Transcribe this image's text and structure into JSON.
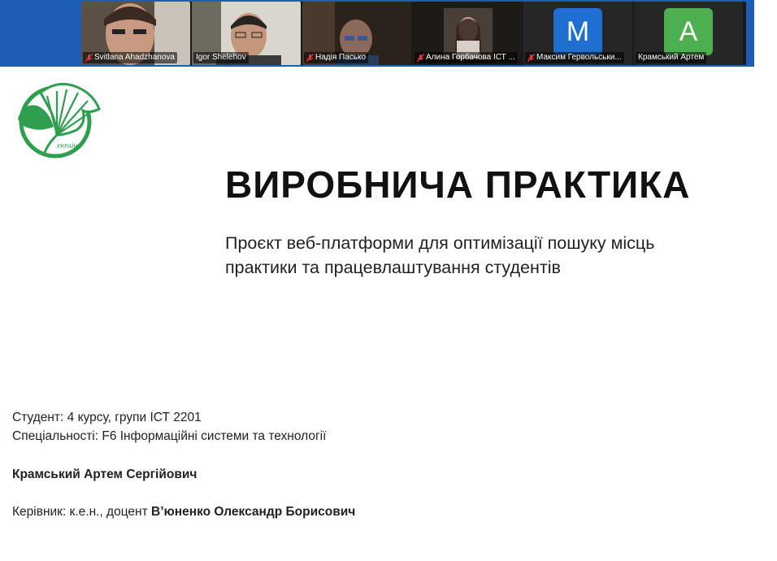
{
  "participants": [
    {
      "name": "Svitlana Ahadzhanova",
      "muted": true,
      "video": true
    },
    {
      "name": "Igor Shelehov",
      "muted": false,
      "video": true,
      "speaking": true
    },
    {
      "name": "Надія Пасько",
      "muted": true,
      "video": true
    },
    {
      "name": "Алина Горбачова ІСТ ...",
      "muted": true,
      "video": true
    },
    {
      "name": "Максим Гервольськи...",
      "muted": true,
      "video": false,
      "avatar_letter": "M",
      "avatar_color": "#1e6fd0"
    },
    {
      "name": "Крамський Артем",
      "muted": false,
      "video": false,
      "avatar_letter": "A",
      "avatar_color": "#4caf50"
    }
  ],
  "slide": {
    "logo_text": "УКРАЇНА",
    "title": "ВИРОБНИЧА ПРАКТИКА",
    "subtitle_line1": "Проєкт веб-платформи для оптимізації пошуку місць",
    "subtitle_line2": "практики та працевлаштування студентів",
    "student_line": "Студент: 4 курсу, групи ІСТ 2201",
    "specialty_line": "Спеціальності: F6 Інформаційні системи та технології",
    "student_name": "Крамський Артем Сергійович",
    "supervisor_prefix": "Керівник: к.е.н., доцент",
    "supervisor_name": "В’юненко Олександр Борисович"
  },
  "colors": {
    "strip": "#1d5db5",
    "brand_green": "#2e9e4f",
    "speaking": "#3ddc84",
    "muted_mic": "#e53935"
  }
}
